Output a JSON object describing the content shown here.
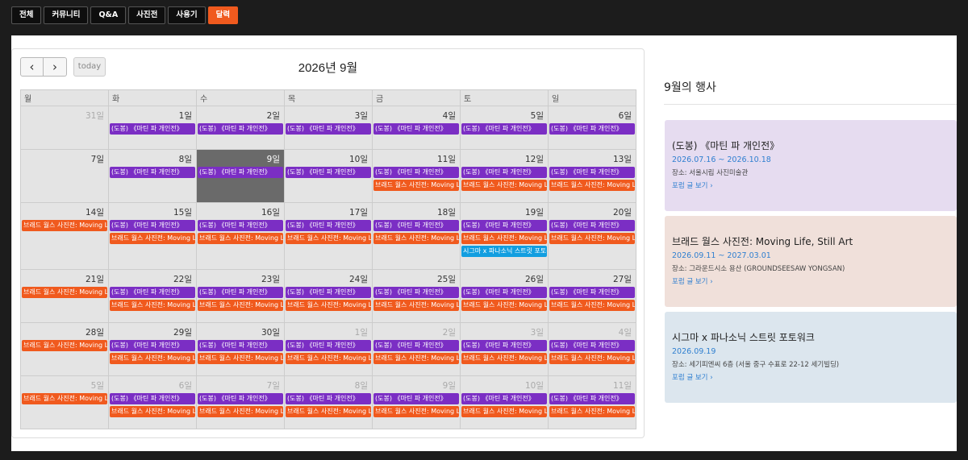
{
  "nav": {
    "tabs": [
      "전체",
      "커뮤니티",
      "Q&A",
      "사진전",
      "사용기",
      "달력"
    ],
    "active": "달력"
  },
  "calendar": {
    "title": "2026년 9월",
    "today_label": "today",
    "prev_icon": "chevron-left-icon",
    "next_icon": "chevron-right-icon",
    "weekdays": [
      "월",
      "화",
      "수",
      "목",
      "금",
      "토",
      "일"
    ],
    "event_labels": {
      "A": "(도봉) 《마틴 파 개인전》",
      "B": "브래드 월스 사진전: Moving Life, Still Art",
      "C": "시그마 x 파나소닉 스트릿 포토워크"
    },
    "colors": {
      "A": "#7b2ec4",
      "B": "#f05a1e",
      "C": "#129ee0",
      "today_bg": "#6a6a6a"
    },
    "weeks": [
      {
        "days": [
          {
            "n": "31일",
            "other": true,
            "ev": []
          },
          {
            "n": "1일",
            "ev": [
              "A"
            ]
          },
          {
            "n": "2일",
            "ev": [
              "A"
            ]
          },
          {
            "n": "3일",
            "ev": [
              "A"
            ]
          },
          {
            "n": "4일",
            "ev": [
              "A"
            ]
          },
          {
            "n": "5일",
            "ev": [
              "A"
            ]
          },
          {
            "n": "6일",
            "ev": [
              "A"
            ]
          }
        ]
      },
      {
        "days": [
          {
            "n": "7일",
            "ev": []
          },
          {
            "n": "8일",
            "ev": [
              "A"
            ]
          },
          {
            "n": "9일",
            "today": true,
            "ev": [
              "A"
            ]
          },
          {
            "n": "10일",
            "ev": [
              "A"
            ]
          },
          {
            "n": "11일",
            "ev": [
              "A",
              "B"
            ]
          },
          {
            "n": "12일",
            "ev": [
              "A",
              "B"
            ]
          },
          {
            "n": "13일",
            "ev": [
              "A",
              "B"
            ]
          }
        ]
      },
      {
        "days": [
          {
            "n": "14일",
            "ev": [
              "B"
            ]
          },
          {
            "n": "15일",
            "ev": [
              "A",
              "B"
            ]
          },
          {
            "n": "16일",
            "ev": [
              "A",
              "B"
            ]
          },
          {
            "n": "17일",
            "ev": [
              "A",
              "B"
            ]
          },
          {
            "n": "18일",
            "ev": [
              "A",
              "B"
            ]
          },
          {
            "n": "19일",
            "ev": [
              "A",
              "B",
              "C"
            ]
          },
          {
            "n": "20일",
            "ev": [
              "A",
              "B"
            ]
          }
        ]
      },
      {
        "days": [
          {
            "n": "21일",
            "ev": [
              "B"
            ]
          },
          {
            "n": "22일",
            "ev": [
              "A",
              "B"
            ]
          },
          {
            "n": "23일",
            "ev": [
              "A",
              "B"
            ]
          },
          {
            "n": "24일",
            "ev": [
              "A",
              "B"
            ]
          },
          {
            "n": "25일",
            "ev": [
              "A",
              "B"
            ]
          },
          {
            "n": "26일",
            "ev": [
              "A",
              "B"
            ]
          },
          {
            "n": "27일",
            "ev": [
              "A",
              "B"
            ]
          }
        ]
      },
      {
        "days": [
          {
            "n": "28일",
            "ev": [
              "B"
            ]
          },
          {
            "n": "29일",
            "ev": [
              "A",
              "B"
            ]
          },
          {
            "n": "30일",
            "ev": [
              "A",
              "B"
            ]
          },
          {
            "n": "1일",
            "other": true,
            "ev": [
              "A",
              "B"
            ]
          },
          {
            "n": "2일",
            "other": true,
            "ev": [
              "A",
              "B"
            ]
          },
          {
            "n": "3일",
            "other": true,
            "ev": [
              "A",
              "B"
            ]
          },
          {
            "n": "4일",
            "other": true,
            "ev": [
              "A",
              "B"
            ]
          }
        ]
      },
      {
        "days": [
          {
            "n": "5일",
            "other": true,
            "ev": [
              "B"
            ]
          },
          {
            "n": "6일",
            "other": true,
            "ev": [
              "A",
              "B"
            ]
          },
          {
            "n": "7일",
            "other": true,
            "ev": [
              "A",
              "B"
            ]
          },
          {
            "n": "8일",
            "other": true,
            "ev": [
              "A",
              "B"
            ]
          },
          {
            "n": "9일",
            "other": true,
            "ev": [
              "A",
              "B"
            ]
          },
          {
            "n": "10일",
            "other": true,
            "ev": [
              "A",
              "B"
            ]
          },
          {
            "n": "11일",
            "other": true,
            "ev": [
              "A",
              "B"
            ]
          }
        ]
      }
    ]
  },
  "sidebar": {
    "title": "9월의 행사",
    "events": [
      {
        "title": "(도봉) 《마틴 파 개인전》",
        "dates": "2026.07.16 ~ 2026.10.18",
        "place": "장소: 서울시립 사진미술관",
        "link": "포럼 글 보기 ›",
        "bg": "#e6dcf0"
      },
      {
        "title": "브래드 월스 사진전: Moving Life, Still Art",
        "dates": "2026.09.11 ~ 2027.03.01",
        "place": "장소: 그라운드시소 용산 (GROUNDSEESAW YONGSAN)",
        "link": "포럼 글 보기 ›",
        "bg": "#f0e0da"
      },
      {
        "title": "시그마 x 파나소닉 스트릿 포토워크",
        "dates": "2026.09.19",
        "place": "장소: 세기피엔씨 6층 (서울 중구 수표로 22-12 세기빌딩)",
        "link": "포럼 글 보기 ›",
        "bg": "#dce6ee"
      }
    ]
  }
}
